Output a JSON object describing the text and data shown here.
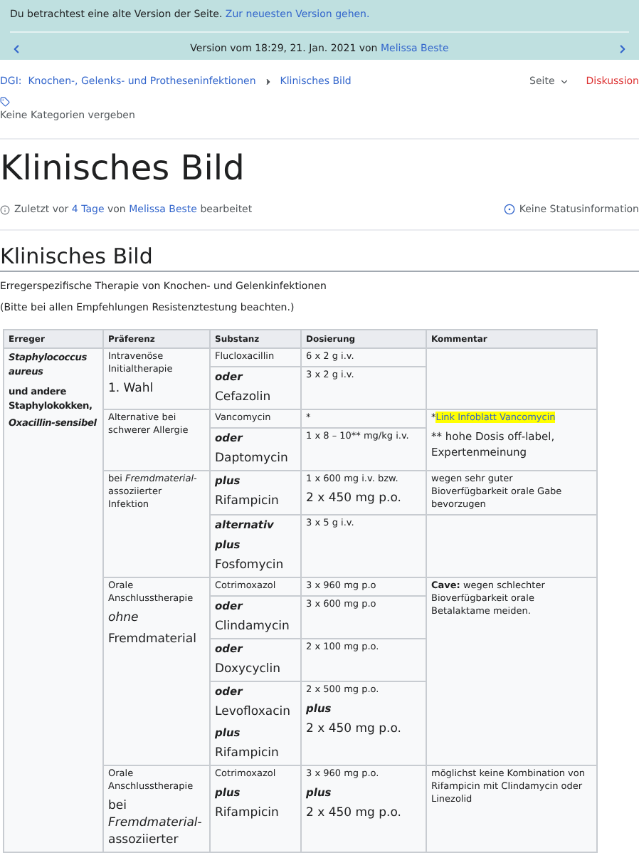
{
  "notice": {
    "text": "Du betrachtest eine alte Version der Seite.",
    "link": "Zur neuesten Version gehen."
  },
  "version_nav": {
    "text": "Version vom 18:29, 21. Jan. 2021 von",
    "author": "Melissa Beste"
  },
  "breadcrumb": [
    {
      "label": "DGI:  Knochen-, Gelenks- und Protheseninfektionen"
    },
    {
      "label": "Klinisches Bild"
    }
  ],
  "page_actions": [
    {
      "label": "Seite",
      "kind": "menu"
    },
    {
      "label": "Diskussion",
      "kind": "link"
    }
  ],
  "categories": "Keine Kategorien vergeben",
  "title": "Klinisches Bild",
  "edit_info": {
    "prefix": "Zuletzt vor",
    "age": "4 Tage",
    "middle": "von",
    "author": "Melissa Beste",
    "suffix": "bearbeitet"
  },
  "status": "Keine Statusinformation",
  "section": {
    "heading": "Klinisches Bild",
    "paragraphs": [
      "Erregerspezifische Therapie von Knochen- und Gelenkinfektionen",
      "(Bitte bei allen Empfehlungen Resistenztestung beachten.)"
    ]
  },
  "table": {
    "columns": [
      "Erreger",
      "Präferenz",
      "Substanz",
      "Dosierung",
      "Kommentar"
    ],
    "groups": [
      {
        "erreger": [
          {
            "text": "Staphylococcus aureus",
            "kind": "emph"
          },
          {
            "text": "und andere Staphylokokken,",
            "kind": "strong"
          },
          {
            "text": "Oxacillin-sensibel",
            "kind": "emph"
          }
        ],
        "preferences": [
          {
            "paragraphs": [
              {
                "text": "Intravenöse Initialtherapie",
                "kind": "small"
              },
              {
                "text": "1. Wahl",
                "kind": "large"
              }
            ],
            "blocks": [
              {
                "options": [
                  {
                    "substance": [
                      {
                        "text": "Flucloxacillin",
                        "kind": "small"
                      }
                    ],
                    "dosage": [
                      {
                        "text": "6 x 2 g i.v.",
                        "kind": "small"
                      }
                    ]
                  },
                  {
                    "substance": [
                      {
                        "text": "oder",
                        "kind": "connector"
                      },
                      {
                        "text": "Cefazolin",
                        "kind": "large"
                      }
                    ],
                    "dosage": [
                      {
                        "text": "3 x 2 g i.v.",
                        "kind": "small"
                      }
                    ]
                  }
                ]
              }
            ]
          },
          {
            "paragraphs": [
              {
                "text": "Alternative bei schwerer Allergie",
                "kind": "small"
              }
            ],
            "blocks": [
              {
                "comment": [
                  {
                    "text": "*",
                    "link": "Link Infoblatt Vancomycin",
                    "kind": "small"
                  },
                  {
                    "text": "** hohe Dosis off-label, Expertenmeinung",
                    "kind": "medium"
                  }
                ],
                "options": [
                  {
                    "substance": [
                      {
                        "text": "Vancomycin",
                        "kind": "small"
                      }
                    ],
                    "dosage": [
                      {
                        "text": "*",
                        "kind": "small"
                      }
                    ]
                  },
                  {
                    "substance": [
                      {
                        "text": "oder",
                        "kind": "connector"
                      },
                      {
                        "text": "Daptomycin",
                        "kind": "large"
                      }
                    ],
                    "dosage": [
                      {
                        "text": "1 x 8 – 10** mg/kg i.v.",
                        "kind": "small"
                      }
                    ]
                  }
                ]
              }
            ]
          },
          {
            "paragraphs": [
              {
                "text": "bei *Fremdmaterial*-assoziierter Infektion",
                "kind": "small",
                "rich": true
              }
            ],
            "blocks": [
              {
                "comment": [
                  {
                    "text": "wegen sehr guter Bioverfügbarkeit orale Gabe bevorzugen",
                    "kind": "small"
                  }
                ],
                "options": [
                  {
                    "substance": [
                      {
                        "text": "plus",
                        "kind": "connector"
                      },
                      {
                        "text": "Rifampicin",
                        "kind": "large"
                      }
                    ],
                    "dosage": [
                      {
                        "text": "1 x 600 mg i.v. bzw.",
                        "kind": "small"
                      },
                      {
                        "text": "2 x 450 mg p.o.",
                        "kind": "large"
                      }
                    ]
                  }
                ]
              },
              {
                "options": [
                  {
                    "substance": [
                      {
                        "text": "alternativ",
                        "kind": "connector"
                      },
                      {
                        "text": "plus",
                        "kind": "connector"
                      },
                      {
                        "text": "Fosfomycin",
                        "kind": "large"
                      }
                    ],
                    "dosage": [
                      {
                        "text": "3 x 5 g i.v.",
                        "kind": "small"
                      }
                    ]
                  }
                ]
              }
            ]
          },
          {
            "paragraphs": [
              {
                "text": "Orale Anschlusstherapie",
                "kind": "small"
              },
              {
                "text": "ohne",
                "kind": "italic"
              },
              {
                "text": "Fremdmaterial",
                "kind": "large"
              }
            ],
            "blocks": [
              {
                "comment": [
                  {
                    "text": "**Cave:** wegen schlechter Bioverfügbarkeit orale Betalaktame meiden.",
                    "kind": "small",
                    "rich": true
                  }
                ],
                "options": [
                  {
                    "substance": [
                      {
                        "text": "Cotrimoxazol",
                        "kind": "small"
                      }
                    ],
                    "dosage": [
                      {
                        "text": "3 x 960 mg p.o",
                        "kind": "small"
                      }
                    ]
                  },
                  {
                    "substance": [
                      {
                        "text": "oder",
                        "kind": "connector"
                      },
                      {
                        "text": "Clindamycin",
                        "kind": "large"
                      }
                    ],
                    "dosage": [
                      {
                        "text": "3 x 600 mg p.o",
                        "kind": "small"
                      }
                    ]
                  },
                  {
                    "substance": [
                      {
                        "text": "oder",
                        "kind": "connector"
                      },
                      {
                        "text": "Doxycyclin",
                        "kind": "large"
                      }
                    ],
                    "dosage": [
                      {
                        "text": "2 x 100 mg p.o.",
                        "kind": "small"
                      }
                    ]
                  },
                  {
                    "substance": [
                      {
                        "text": "oder",
                        "kind": "connector"
                      },
                      {
                        "text": "Levofloxacin",
                        "kind": "large"
                      },
                      {
                        "text": "plus",
                        "kind": "connector"
                      },
                      {
                        "text": "Rifampicin",
                        "kind": "large"
                      }
                    ],
                    "dosage": [
                      {
                        "text": "2 x 500 mg p.o.",
                        "kind": "small"
                      },
                      {
                        "text": "plus",
                        "kind": "connector"
                      },
                      {
                        "text": "2 x 450 mg p.o.",
                        "kind": "large"
                      }
                    ]
                  }
                ]
              }
            ]
          },
          {
            "paragraphs": [
              {
                "text": "Orale Anschlusstherapie",
                "kind": "small"
              },
              {
                "text": "bei *Fremdmaterial*-assoziierter",
                "kind": "large",
                "rich": true
              }
            ],
            "blocks": [
              {
                "comment": [
                  {
                    "text": "möglichst keine Kombination von Rifampicin mit Clindamycin oder Linezolid",
                    "kind": "small"
                  }
                ],
                "options": [
                  {
                    "substance": [
                      {
                        "text": "Cotrimoxazol",
                        "kind": "small"
                      },
                      {
                        "text": "plus",
                        "kind": "connector"
                      },
                      {
                        "text": "Rifampicin",
                        "kind": "large"
                      }
                    ],
                    "dosage": [
                      {
                        "text": "3 x 960 mg p.o.",
                        "kind": "small"
                      },
                      {
                        "text": "plus",
                        "kind": "connector"
                      },
                      {
                        "text": "2 x 450 mg p.o.",
                        "kind": "large"
                      }
                    ]
                  }
                ]
              }
            ]
          }
        ]
      }
    ]
  }
}
